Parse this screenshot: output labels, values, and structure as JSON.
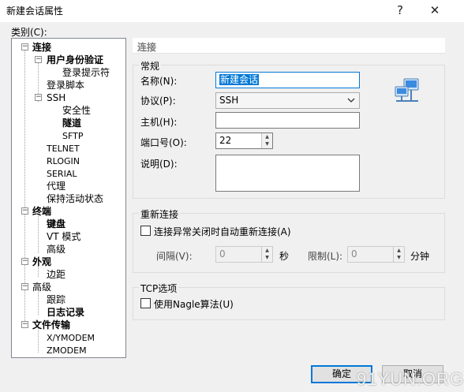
{
  "window": {
    "title": "新建会话属性",
    "help_glyph": "?",
    "close_glyph": "✕"
  },
  "category_label": "类别(C):",
  "tree": [
    {
      "label": "连接",
      "bold": true
    },
    {
      "label": "用户身份验证",
      "bold": true
    },
    {
      "label": "登录提示符",
      "bold": false
    },
    {
      "label": "登录脚本",
      "bold": false
    },
    {
      "label": "SSH",
      "bold": false
    },
    {
      "label": "安全性",
      "bold": false
    },
    {
      "label": "隧道",
      "bold": true
    },
    {
      "label": "SFTP",
      "bold": false
    },
    {
      "label": "TELNET",
      "bold": false
    },
    {
      "label": "RLOGIN",
      "bold": false
    },
    {
      "label": "SERIAL",
      "bold": false
    },
    {
      "label": "代理",
      "bold": false
    },
    {
      "label": "保持活动状态",
      "bold": false
    },
    {
      "label": "终端",
      "bold": true
    },
    {
      "label": "键盘",
      "bold": true
    },
    {
      "label": "VT 模式",
      "bold": false
    },
    {
      "label": "高级",
      "bold": false
    },
    {
      "label": "外观",
      "bold": true
    },
    {
      "label": "边距",
      "bold": false
    },
    {
      "label": "高级",
      "bold": false
    },
    {
      "label": "跟踪",
      "bold": false
    },
    {
      "label": "日志记录",
      "bold": true
    },
    {
      "label": "文件传输",
      "bold": true
    },
    {
      "label": "X/YMODEM",
      "bold": false
    },
    {
      "label": "ZMODEM",
      "bold": false
    }
  ],
  "pane": {
    "title": "连接",
    "general": {
      "legend": "常规",
      "name_label": "名称(N):",
      "name_value": "新建会话",
      "protocol_label": "协议(P):",
      "protocol_value": "SSH",
      "host_label": "主机(H):",
      "host_value": "",
      "port_label": "端口号(O):",
      "port_value": "22",
      "desc_label": "说明(D):",
      "desc_value": ""
    },
    "reconnect": {
      "legend": "重新连接",
      "checkbox_label": "连接异常关闭时自动重新连接(A)",
      "interval_label": "间隔(V):",
      "interval_value": "0",
      "interval_unit": "秒",
      "limit_label": "限制(L):",
      "limit_value": "0",
      "limit_unit": "分钟"
    },
    "tcp": {
      "legend": "TCP选项",
      "nagle_label": "使用Nagle算法(U)"
    }
  },
  "buttons": {
    "ok": "确定",
    "cancel": "取消"
  },
  "watermark": "91YUN.ORG"
}
